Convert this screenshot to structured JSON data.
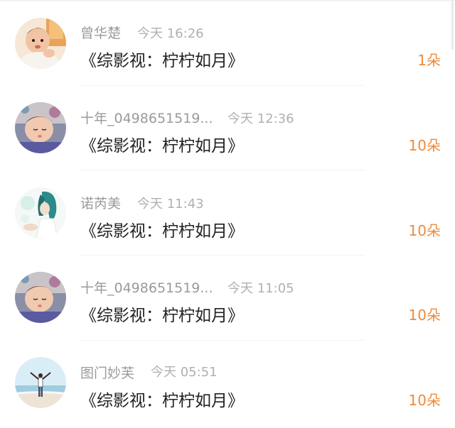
{
  "entries": [
    {
      "user": "曾华楚",
      "time": "今天 16:26",
      "book": "《综影视：柠柠如月》",
      "gift": "1朵",
      "avatar_icon": "baby-avatar"
    },
    {
      "user": "十年_0498651519...",
      "time": "今天 12:36",
      "book": "《综影视：柠柠如月》",
      "gift": "10朵",
      "avatar_icon": "sleeping-baby-avatar"
    },
    {
      "user": "诺芮美",
      "time": "今天 11:43",
      "book": "《综影视：柠柠如月》",
      "gift": "10朵",
      "avatar_icon": "anime-character-avatar"
    },
    {
      "user": "十年_0498651519...",
      "time": "今天 11:05",
      "book": "《综影视：柠柠如月》",
      "gift": "10朵",
      "avatar_icon": "sleeping-baby-avatar"
    },
    {
      "user": "图门妙芙",
      "time": "今天 05:51",
      "book": "《综影视：柠柠如月》",
      "gift": "10朵",
      "avatar_icon": "beach-person-avatar"
    }
  ],
  "colors": {
    "gift": "#ee8a3a",
    "name": "#9a9a9a",
    "time": "#b0b0b0",
    "book": "#222222"
  }
}
